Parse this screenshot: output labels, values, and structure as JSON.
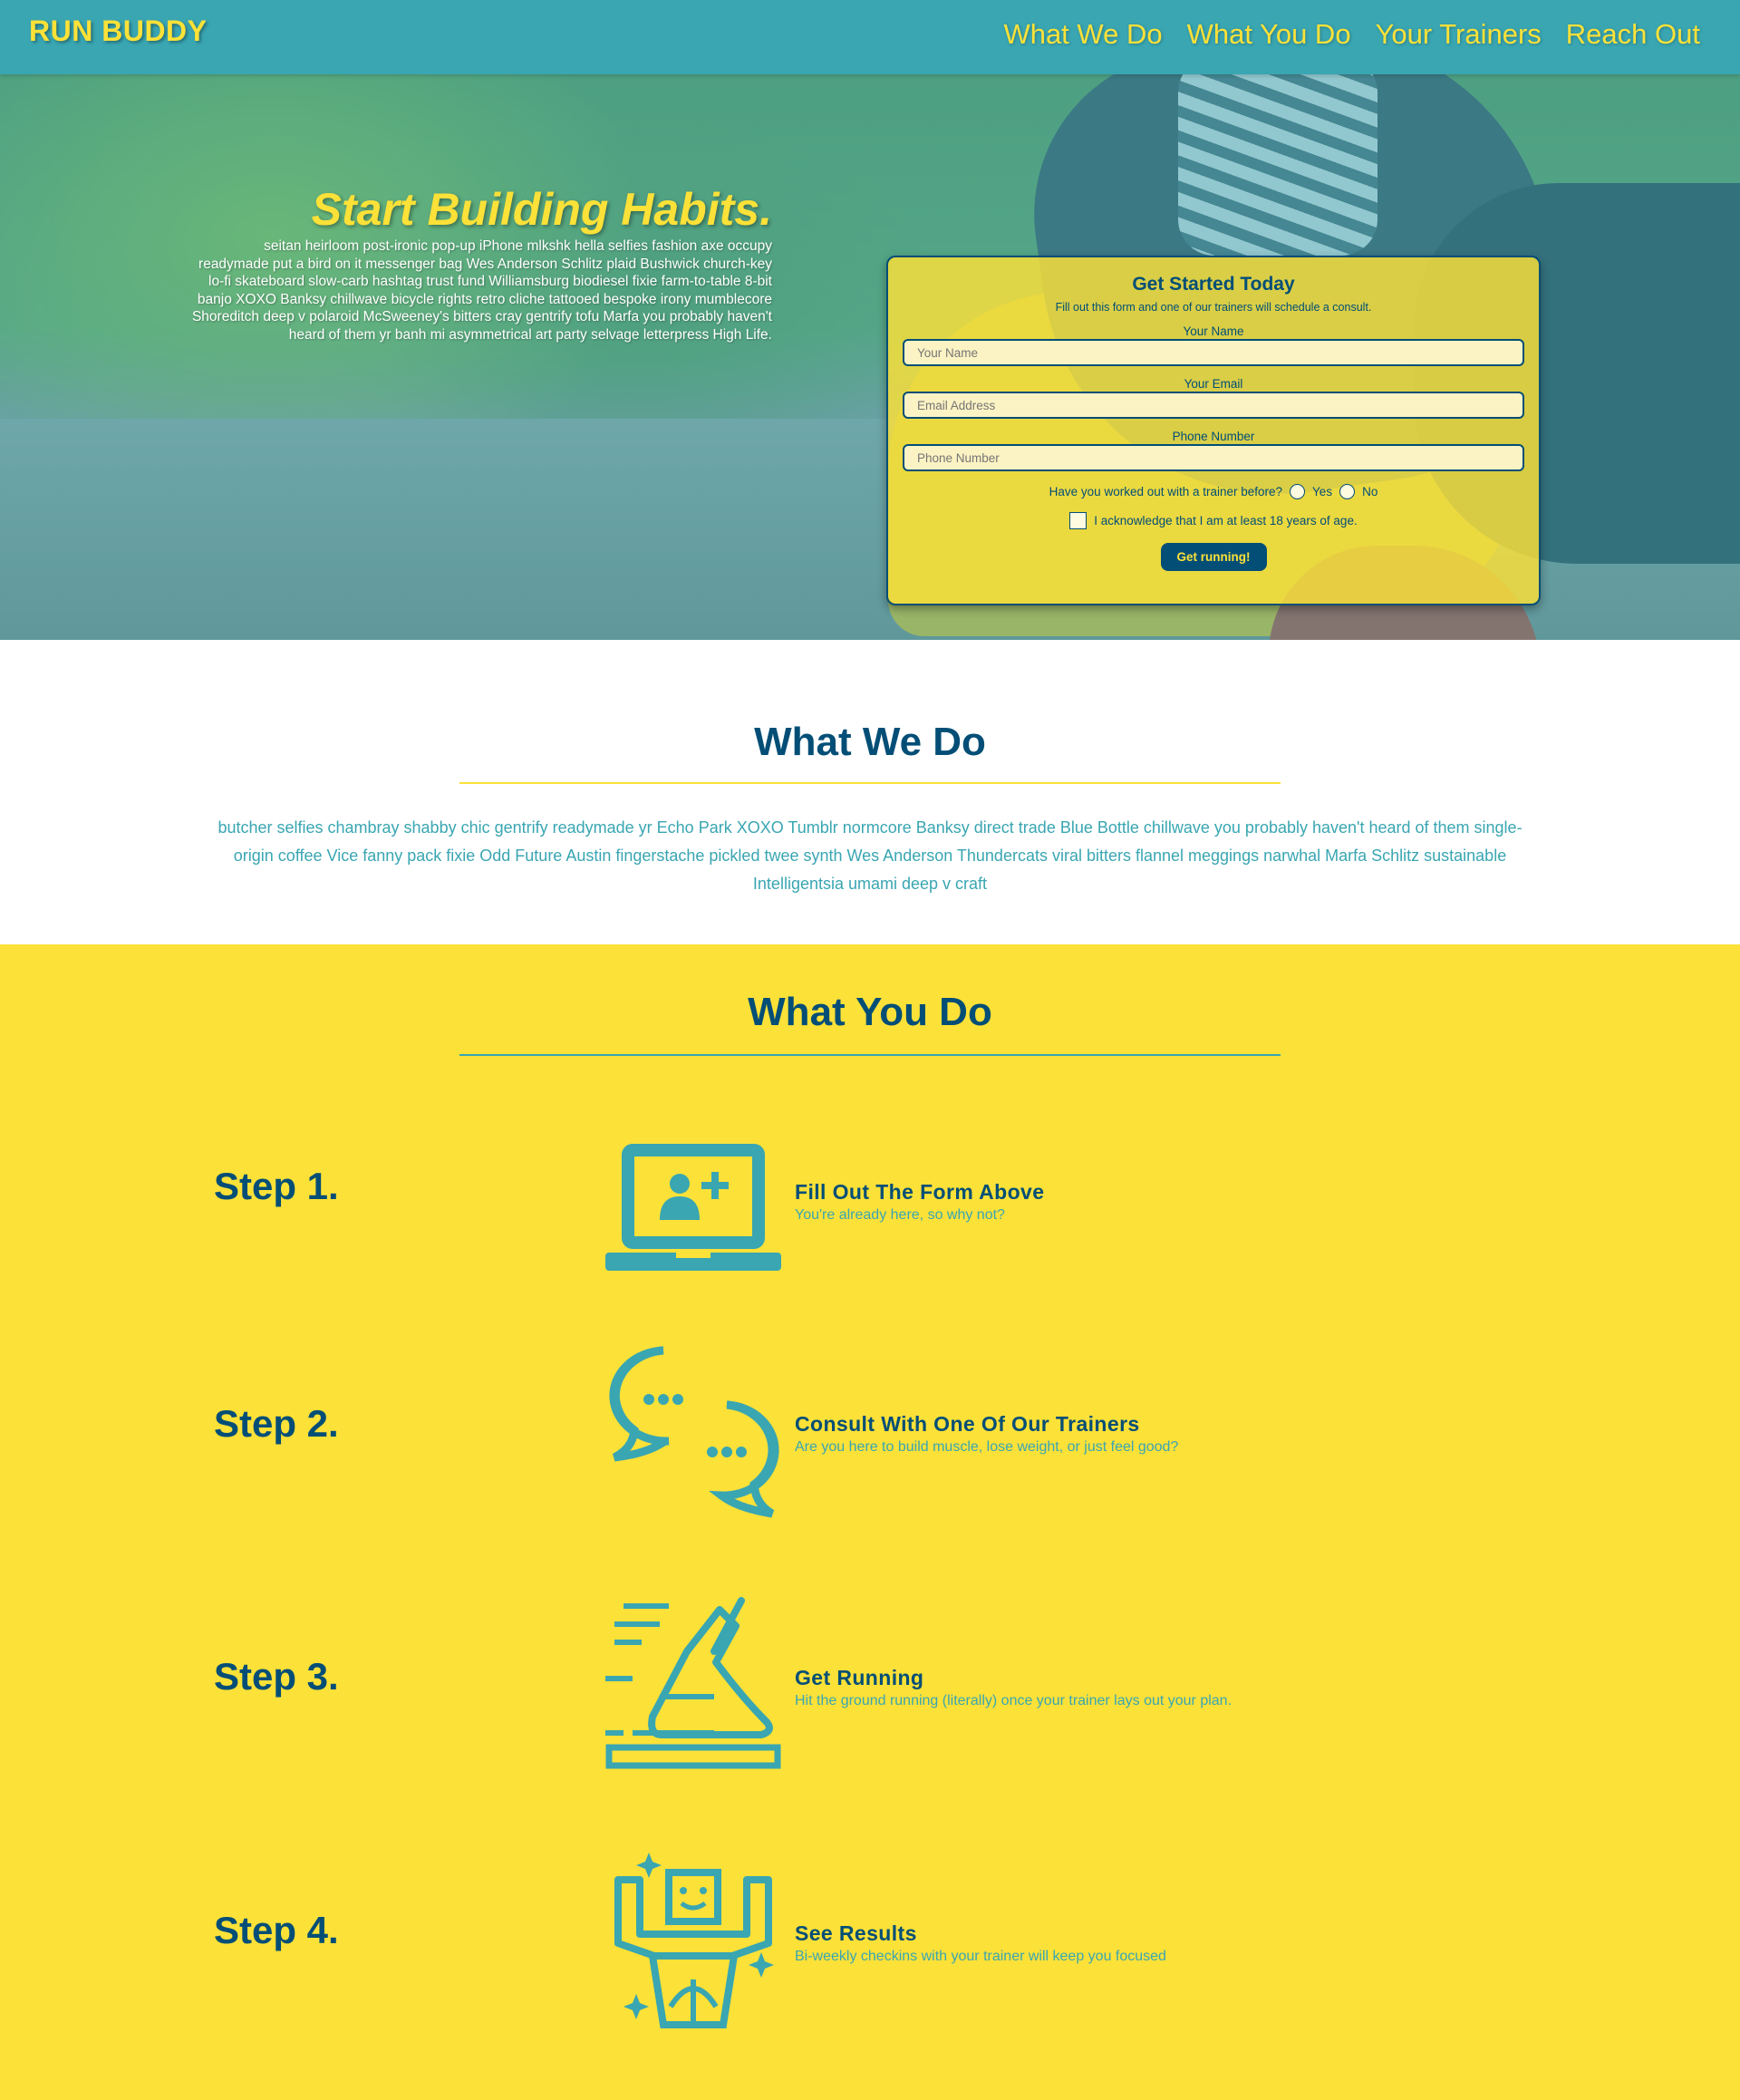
{
  "header": {
    "brand": "RUN BUDDY",
    "nav": [
      "What We Do",
      "What You Do",
      "Your Trainers",
      "Reach Out"
    ]
  },
  "hero": {
    "title": "Start Building Habits.",
    "body": "seitan heirloom post-ironic pop-up iPhone mlkshk hella selfies fashion axe occupy readymade put a bird on it messenger bag Wes Anderson Schlitz plaid Bushwick church-key lo-fi skateboard slow-carb hashtag trust fund Williamsburg biodiesel fixie farm-to-table 8-bit banjo XOXO Banksy chillwave bicycle rights retro cliche tattooed bespoke irony mumblecore Shoreditch deep v polaroid McSweeney's bitters cray gentrify tofu Marfa you probably haven't heard of them yr banh mi asymmetrical art party selvage letterpress High Life."
  },
  "form": {
    "title": "Get Started Today",
    "subtitle": "Fill out this form and one of our trainers will schedule a consult.",
    "name_label": "Your Name",
    "name_placeholder": "Your Name",
    "email_label": "Your Email",
    "email_placeholder": "Email Address",
    "phone_label": "Phone Number",
    "phone_placeholder": "Phone Number",
    "trainer_question": "Have you worked out with a trainer before?",
    "yes_label": "Yes",
    "no_label": "No",
    "acknowledge_label": "I acknowledge that I am at least 18 years of age.",
    "submit_label": "Get running!"
  },
  "what_we_do": {
    "title": "What We Do",
    "body": "butcher selfies chambray shabby chic gentrify readymade yr Echo Park XOXO Tumblr normcore Banksy direct trade Blue Bottle chillwave you probably haven't heard of them single-origin coffee Vice fanny pack fixie Odd Future Austin fingerstache pickled twee synth Wes Anderson Thundercats viral bitters flannel meggings narwhal Marfa Schlitz sustainable Intelligentsia umami deep v craft"
  },
  "what_you_do": {
    "title": "What You Do",
    "steps": [
      {
        "label": "Step 1.",
        "title": "Fill Out The Form Above",
        "desc": "You're already here, so why not?",
        "icon": "laptop-add-user-icon"
      },
      {
        "label": "Step 2.",
        "title": "Consult With One Of Our Trainers",
        "desc": "Are you here to build muscle, lose weight, or just feel good?",
        "icon": "chat-bubbles-icon"
      },
      {
        "label": "Step 3.",
        "title": "Get Running",
        "desc": "Hit the ground running (literally) once your trainer lays out your plan.",
        "icon": "running-shoe-icon"
      },
      {
        "label": "Step 4.",
        "title": "See Results",
        "desc": "Bi-weekly checkins with your trainer will keep you focused",
        "icon": "strong-person-icon"
      }
    ]
  },
  "colors": {
    "primary": "#39a6b2",
    "accent": "#fce138",
    "dark": "#024e76"
  }
}
